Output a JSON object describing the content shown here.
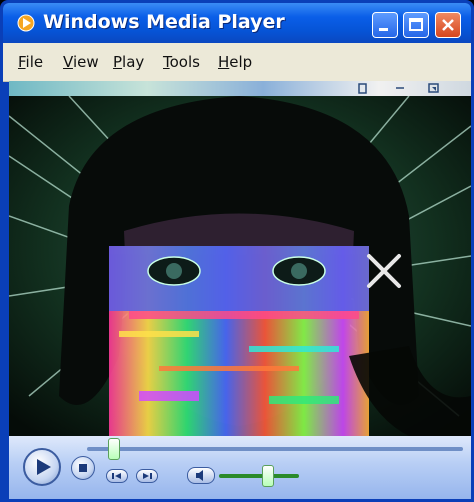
{
  "window": {
    "title": "Windows Media Player",
    "title_icon": "wmp-logo-icon",
    "controls": {
      "minimize_icon": "minimize-icon",
      "maximize_icon": "maximize-icon",
      "close_icon": "close-icon"
    }
  },
  "menu": {
    "items": [
      {
        "label": "File",
        "access_key": "F"
      },
      {
        "label": "View",
        "access_key": "V"
      },
      {
        "label": "Play",
        "access_key": "P"
      },
      {
        "label": "Tools",
        "access_key": "T"
      },
      {
        "label": "Help",
        "access_key": "H"
      }
    ]
  },
  "video": {
    "description_icon": "video-frame"
  },
  "transport": {
    "seek_position": 0.07,
    "volume_level": 0.6,
    "icons": [
      "play-icon",
      "stop-icon",
      "previous-icon",
      "next-icon",
      "mute-icon"
    ]
  },
  "colors": {
    "title_bar": "#0a5ee8",
    "menu_bar": "#ece9d8",
    "transport": "#b9cff5",
    "close_button": "#d6461e"
  }
}
